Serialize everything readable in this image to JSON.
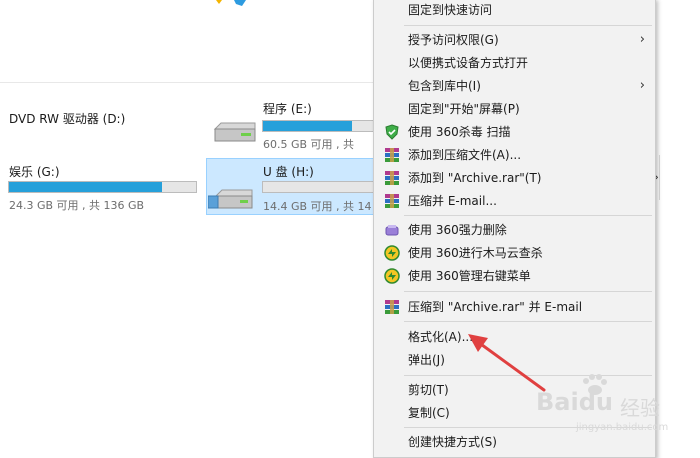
{
  "drives": [
    {
      "name": "DVD RW 驱动器 (D:)"
    },
    {
      "name": "程序 (E:)",
      "info": "60.5 GB 可用 , 共 ",
      "used_fraction": 0.8
    },
    {
      "name": "娱乐 (G:)",
      "info": "24.3 GB 可用 , 共 136 GB",
      "used_fraction": 0.82
    },
    {
      "name": "U 盘 (H:)",
      "info": "14.4 GB 可用 , 共 14",
      "used_fraction": 0.0,
      "selected": true
    }
  ],
  "menu": {
    "items": [
      {
        "label": "固定到快速访问"
      },
      {
        "label": "授予访问权限(G)",
        "submenu": true
      },
      {
        "label": "以便携式设备方式打开"
      },
      {
        "label": "包含到库中(I)",
        "submenu": true
      },
      {
        "label": "固定到\"开始\"屏幕(P)"
      },
      {
        "label": "使用 360杀毒 扫描",
        "icon": "shield-360-icon"
      },
      {
        "label": "添加到压缩文件(A)...",
        "icon": "winrar-icon"
      },
      {
        "label": "添加到 \"Archive.rar\"(T)",
        "icon": "winrar-icon"
      },
      {
        "label": "压缩并 E-mail...",
        "icon": "winrar-icon"
      },
      {
        "label": "使用 360强力删除",
        "icon": "eraser-icon"
      },
      {
        "label": "使用 360进行木马云查杀",
        "icon": "360-security-icon"
      },
      {
        "label": "使用 360管理右键菜单",
        "icon": "360-security-icon"
      },
      {
        "label": "压缩到 \"Archive.rar\" 并 E-mail",
        "icon": "winrar-icon"
      },
      {
        "label": "格式化(A)..."
      },
      {
        "label": "弹出(J)"
      },
      {
        "label": "剪切(T)"
      },
      {
        "label": "复制(C)"
      },
      {
        "label": "创建快捷方式(S)"
      }
    ]
  },
  "watermark": {
    "brand": "Baidu",
    "cn": "经验",
    "sub": "jingyan.baidu.com"
  },
  "colors": {
    "accent": "#26a0da",
    "selection": "#cce8ff",
    "arrow": "#e04040"
  }
}
